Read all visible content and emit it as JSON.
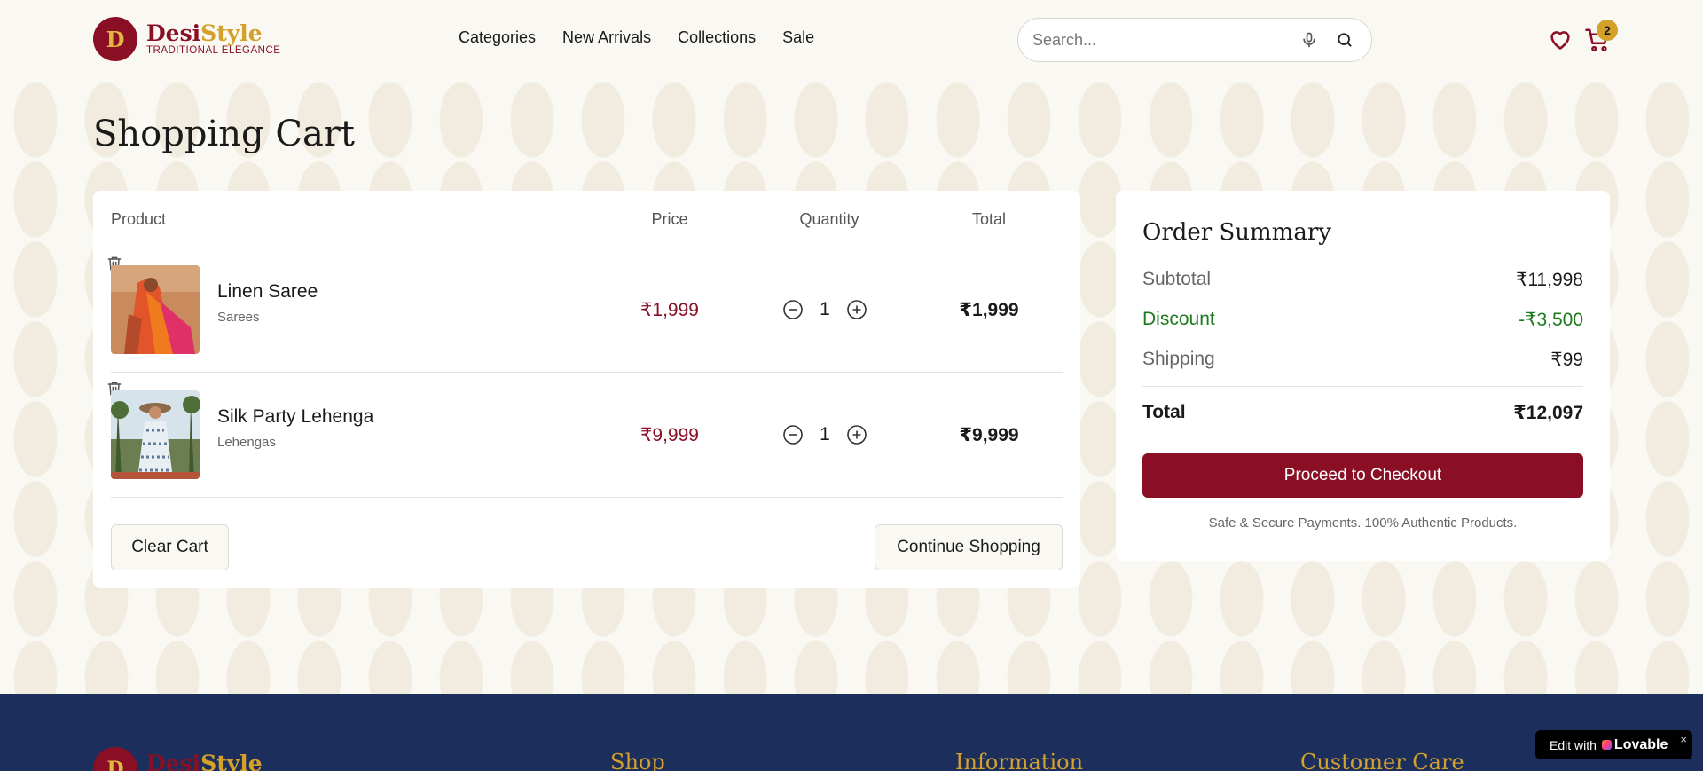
{
  "brand": {
    "initial": "D",
    "name_part1": "Desi",
    "name_part2": "Style",
    "tagline": "TRADITIONAL ELEGANCE"
  },
  "nav": [
    "Categories",
    "New Arrivals",
    "Collections",
    "Sale"
  ],
  "search": {
    "placeholder": "Search..."
  },
  "cart_count": "2",
  "page_title": "Shopping Cart",
  "table_headers": {
    "product": "Product",
    "price": "Price",
    "quantity": "Quantity",
    "total": "Total"
  },
  "items": [
    {
      "name": "Linen Saree",
      "category": "Sarees",
      "price": "₹1,999",
      "quantity": "1",
      "total": "₹1,999"
    },
    {
      "name": "Silk Party Lehenga",
      "category": "Lehengas",
      "price": "₹9,999",
      "quantity": "1",
      "total": "₹9,999"
    }
  ],
  "actions": {
    "clear": "Clear Cart",
    "continue": "Continue Shopping"
  },
  "summary": {
    "title": "Order Summary",
    "subtotal_label": "Subtotal",
    "subtotal": "₹11,998",
    "discount_label": "Discount",
    "discount": "-₹3,500",
    "shipping_label": "Shipping",
    "shipping": "₹99",
    "total_label": "Total",
    "total": "₹12,097",
    "checkout": "Proceed to Checkout",
    "secure_note": "Safe & Secure Payments. 100% Authentic Products."
  },
  "footer": {
    "headings": [
      "Shop",
      "Information",
      "Customer Care"
    ]
  },
  "badge": {
    "prefix": "Edit with",
    "brand": "Lovable",
    "close": "×"
  },
  "colors": {
    "primary": "#8a0f24",
    "gold": "#d4a12a",
    "footer": "#1c2f5c",
    "discount": "#1f7a1f"
  }
}
